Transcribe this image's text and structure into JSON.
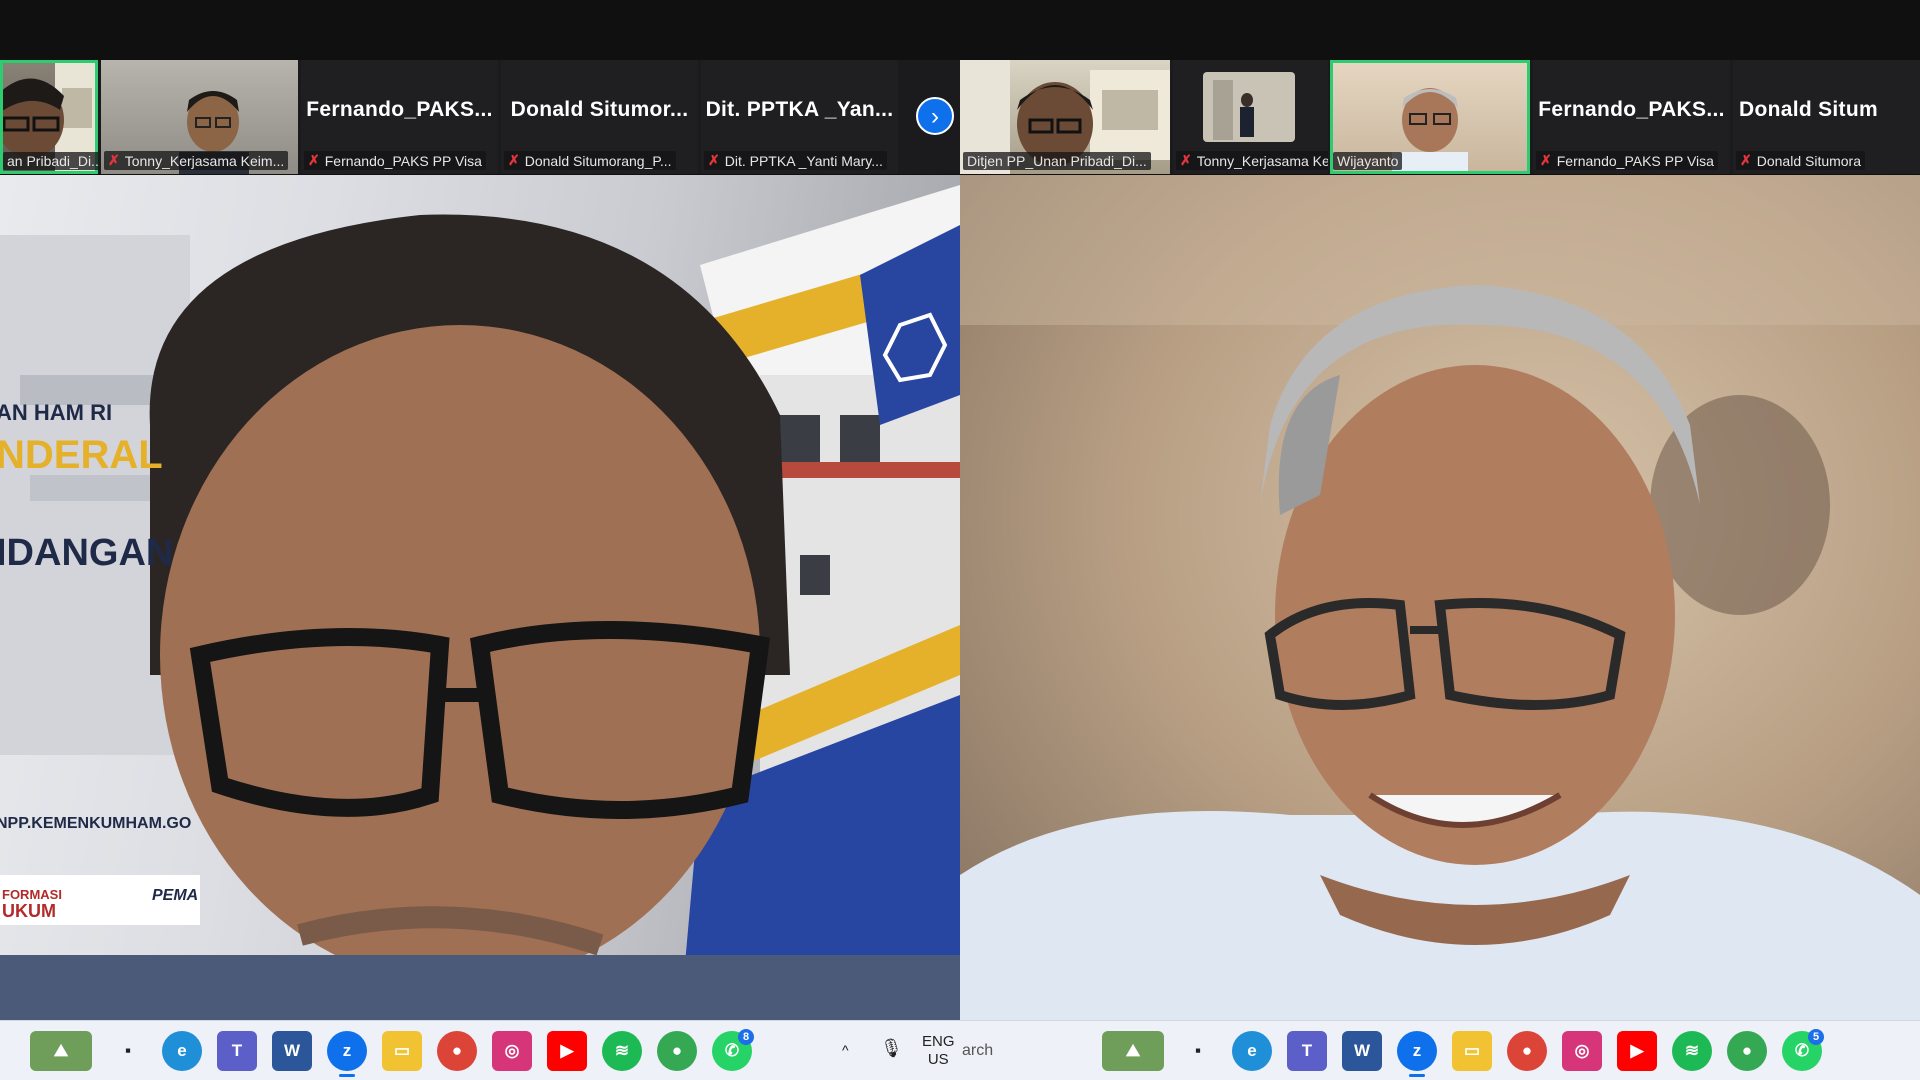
{
  "left_window": {
    "strip": {
      "tiles": [
        {
          "caption": "an Pribadi_Di...",
          "active": true
        },
        {
          "caption": "Tonny_Kerjasama Keim..."
        },
        {
          "name": "Fernando_PAKS...",
          "caption": "Fernando_PAKS PP Visa"
        },
        {
          "name": "Donald  Situmor...",
          "caption": "Donald Situmorang_P..."
        },
        {
          "name": "Dit. PPTKA _Yan...",
          "caption": "Dit. PPTKA _Yanti Mary..."
        }
      ],
      "next_icon": "chevron-right-icon"
    },
    "background_texts": [
      "AN HAM RI",
      "NDERAL",
      "IDANGAN",
      "NPP.KEMENKUMHAM.GO",
      "FORMASI",
      "UKUM",
      "PEMA"
    ]
  },
  "right_window": {
    "strip": {
      "tiles": [
        {
          "caption": "Ditjen PP_Unan Pribadi_Di..."
        },
        {
          "caption": "Tonny_Kerjasama Keim..."
        },
        {
          "caption": "Wijayanto",
          "active": true
        },
        {
          "name": "Fernando_PAKS...",
          "caption": "Fernando_PAKS PP Visa"
        },
        {
          "name": "Donald  Situm",
          "caption": "Donald Situmora"
        }
      ]
    }
  },
  "taskbar_left": {
    "system": {
      "lang_line1": "ENG",
      "lang_line2": "US",
      "chevron": "^"
    },
    "whatsapp_badge": "8"
  },
  "taskbar_right": {
    "search_text": "arch",
    "whatsapp_badge": "5"
  }
}
